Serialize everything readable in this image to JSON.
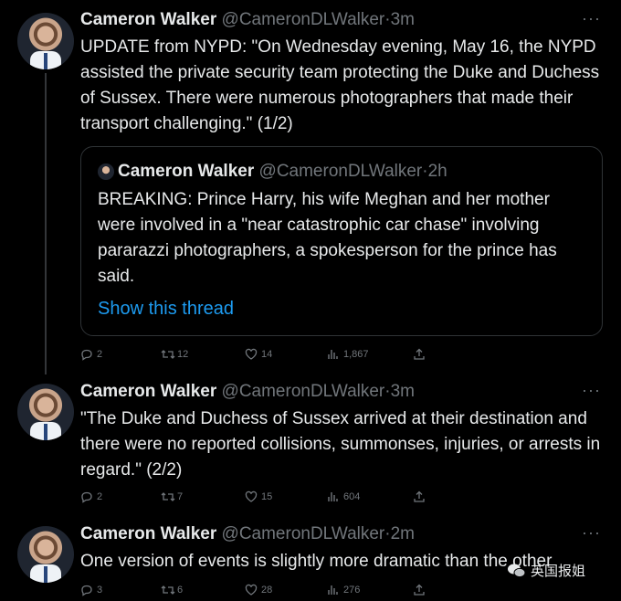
{
  "tweets": [
    {
      "name": "Cameron Walker",
      "handle": "@CameronDLWalker",
      "dot": "·",
      "time": "3m",
      "text": "UPDATE from NYPD: \"On Wednesday evening, May 16, the NYPD assisted the private security team protecting the Duke and Duchess of Sussex.  There were numerous photographers that made their transport challenging.\" (1/2)",
      "quote": {
        "name": "Cameron Walker",
        "handle": "@CameronDLWalker",
        "dot": "·",
        "time": "2h",
        "text": "BREAKING: Prince Harry, his wife Meghan and her mother were involved in a \"near catastrophic car chase\" involving pararazzi photographers, a spokesperson for the prince has said.",
        "link": "Show this thread"
      },
      "replies": "2",
      "retweets": "12",
      "likes": "14",
      "views": "1,867"
    },
    {
      "name": "Cameron Walker",
      "handle": "@CameronDLWalker",
      "dot": "·",
      "time": "3m",
      "text": "\"The Duke and Duchess of Sussex arrived at their destination and there were no reported collisions, summonses, injuries, or arrests in regard.\" (2/2)",
      "replies": "2",
      "retweets": "7",
      "likes": "15",
      "views": "604"
    },
    {
      "name": "Cameron Walker",
      "handle": "@CameronDLWalker",
      "dot": "·",
      "time": "2m",
      "text": "One version of events is slightly more dramatic than the other",
      "replies": "3",
      "retweets": "6",
      "likes": "28",
      "views": "276"
    }
  ],
  "more_label": "···",
  "watermark": "英国报姐",
  "icons": [
    "reply-icon",
    "retweet-icon",
    "like-icon",
    "views-icon",
    "share-icon",
    "more-icon"
  ]
}
